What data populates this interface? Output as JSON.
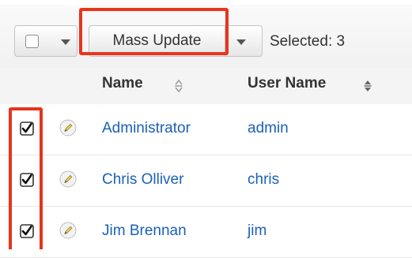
{
  "toolbar": {
    "select_all_checked": false,
    "mass_update_label": "Mass Update",
    "selected_text": "Selected: 3"
  },
  "columns": {
    "name": "Name",
    "user_name": "User Name"
  },
  "rows": [
    {
      "checked": true,
      "name": "Administrator",
      "user_name": "admin"
    },
    {
      "checked": true,
      "name": "Chris Olliver",
      "user_name": "chris"
    },
    {
      "checked": true,
      "name": "Jim Brennan",
      "user_name": "jim"
    }
  ],
  "colors": {
    "link": "#1a61b8",
    "highlight": "#e8341c"
  },
  "icons": [
    "checkbox-icon",
    "chevron-down-icon",
    "sort-icon",
    "pencil-icon",
    "checkbox-checked-icon"
  ]
}
